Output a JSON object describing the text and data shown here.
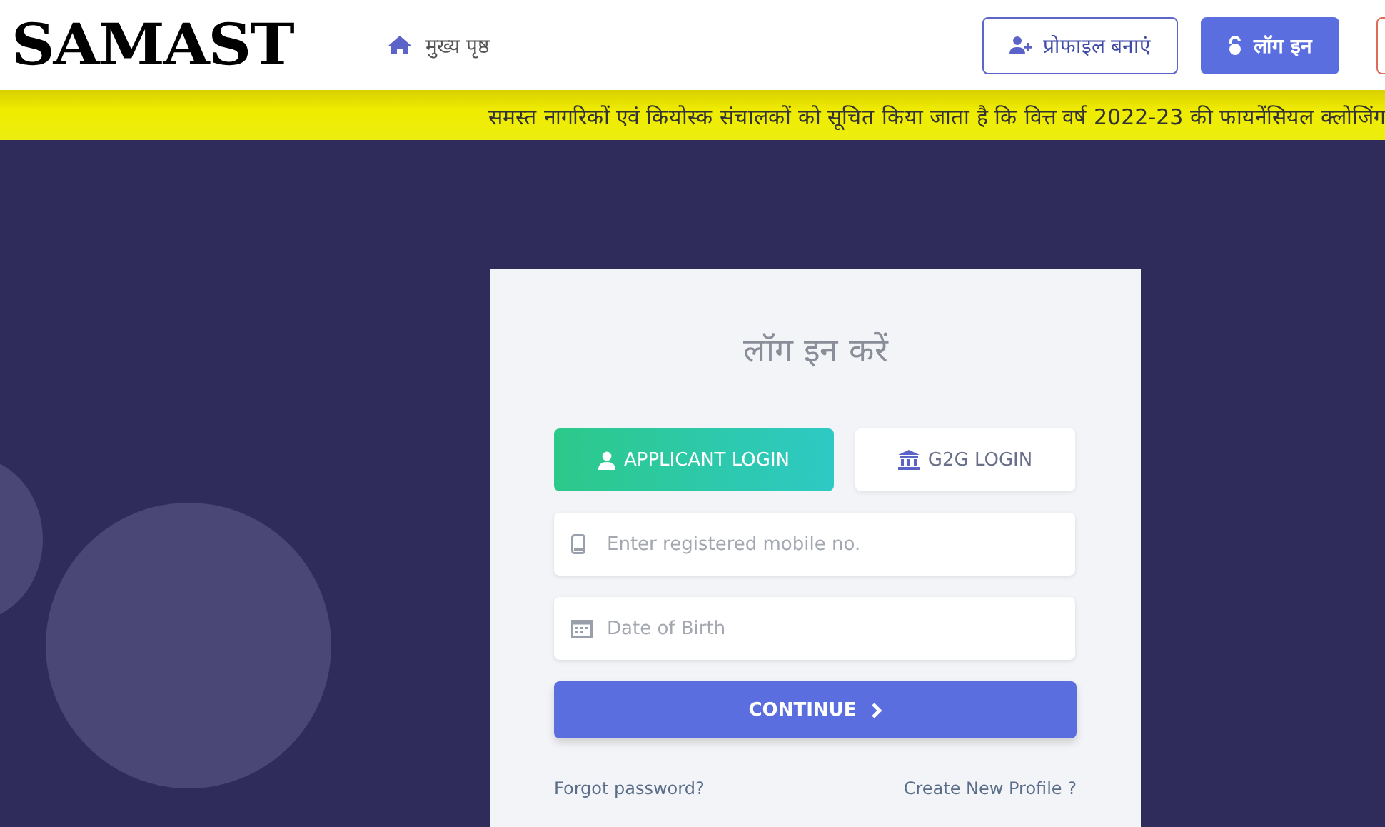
{
  "header": {
    "logo": "SAMAST",
    "nav": [
      {
        "label": "मुख्य पृष्ठ"
      }
    ],
    "buttons": [
      {
        "label": "प्रोफाइल बनाएं",
        "kind": "outline"
      },
      {
        "label": "लॉग इन",
        "kind": "solid"
      }
    ]
  },
  "ticker": {
    "text": "समस्त नागरिकों एवं कियोस्क संचालकों को सूचित किया जाता है कि वित्त वर्ष 2022-23 की फायनेंसियल क्लोजिंग"
  },
  "login": {
    "title": "लॉग इन करें",
    "tabs": [
      {
        "label": "APPLICANT LOGIN",
        "selected": true,
        "kind": "person"
      },
      {
        "label": "G2G LOGIN",
        "selected": false,
        "kind": "bank"
      }
    ],
    "fields": [
      {
        "placeholder": "Enter registered mobile no.",
        "kind": "phone"
      },
      {
        "placeholder": "Date of Birth",
        "kind": "calendar"
      }
    ],
    "submit": "CONTINUE",
    "links": [
      "Forgot password?",
      "Create New Profile ?"
    ]
  }
}
